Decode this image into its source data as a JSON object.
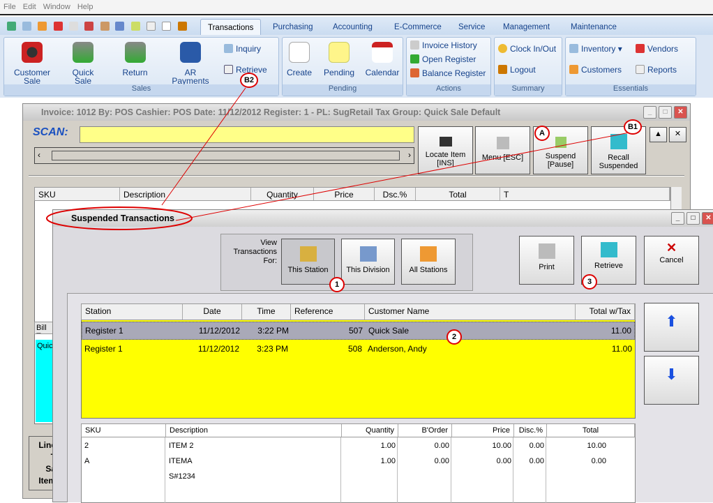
{
  "menu": [
    "File",
    "Edit",
    "Window",
    "Help"
  ],
  "tabs": [
    "Transactions",
    "Purchasing",
    "Accounting",
    "E-Commerce",
    "Service",
    "Management",
    "Maintenance"
  ],
  "ribbon": {
    "sales": {
      "label": "Sales",
      "customer_sale": "Customer Sale",
      "quick_sale": "Quick Sale",
      "return": "Return",
      "ar_payments": "AR Payments",
      "inquiry": "Inquiry",
      "retrieve": "Retrieve"
    },
    "pending": {
      "label": "Pending",
      "create": "Create",
      "pending": "Pending",
      "calendar": "Calendar"
    },
    "actions": {
      "label": "Actions",
      "invoice_history": "Invoice History",
      "open_register": "Open Register",
      "balance_register": "Balance Register"
    },
    "summary": {
      "label": "Summary",
      "clock": "Clock In/Out",
      "logout": "Logout"
    },
    "essentials": {
      "label": "Essentials",
      "inventory": "Inventory",
      "vendors": "Vendors",
      "customers": "Customers",
      "reports": "Reports"
    }
  },
  "invoice": {
    "title": "Invoice: 1012  By: POS  Cashier: POS  Date: 11/12/2012  Register: 1 - PL: SugRetail  Tax Group: Quick Sale Default",
    "scan_label": "SCAN:",
    "scan_value": "",
    "buttons": {
      "locate": "Locate Item [INS]",
      "menu": "Menu [ESC]",
      "suspend": "Suspend [Pause]",
      "recall": "Recall Suspended"
    },
    "columns": [
      "SKU",
      "Description",
      "Quantity",
      "Price",
      "Dsc.%",
      "Total",
      "T"
    ],
    "bill_tab": "Bill T",
    "bill_value": "Quic",
    "totals_labels": [
      "Line",
      "T",
      "Sa",
      "Item"
    ]
  },
  "dialog": {
    "title": "Suspended Transactions",
    "view_for": "View Transactions For:",
    "filters": [
      "This Station",
      "This Division",
      "All Stations"
    ],
    "print": "Print",
    "retrieve": "Retrieve",
    "cancel": "Cancel",
    "columns": [
      "Station",
      "Date",
      "Time",
      "Reference",
      "Customer Name",
      "Total w/Tax"
    ],
    "rows": [
      {
        "station": "Register 1",
        "date": "11/12/2012",
        "time": "3:22 PM",
        "reference": "507",
        "customer": "Quick Sale",
        "total": "11.00"
      },
      {
        "station": "Register 1",
        "date": "11/12/2012",
        "time": "3:23 PM",
        "reference": "508",
        "customer": "Anderson, Andy",
        "total": "11.00"
      }
    ],
    "detail_columns": [
      "SKU",
      "Description",
      "Quantity",
      "B'Order",
      "Price",
      "Disc.%",
      "Total"
    ],
    "detail_rows": [
      {
        "sku": "2",
        "desc": "ITEM 2",
        "qty": "1.00",
        "border": "0.00",
        "price": "10.00",
        "disc": "0.00",
        "total": "10.00"
      },
      {
        "sku": "A",
        "desc": "ITEMA",
        "qty": "1.00",
        "border": "0.00",
        "price": "0.00",
        "disc": "0.00",
        "total": "0.00"
      },
      {
        "sku": "",
        "desc": "S#1234",
        "qty": "",
        "border": "",
        "price": "",
        "disc": "",
        "total": ""
      }
    ]
  },
  "annotations": [
    "A",
    "B1",
    "B2",
    "1",
    "2",
    "3"
  ],
  "colors": {
    "highlight": "#ffff00",
    "selected": "#a9a9b8",
    "cyan": "#00ffff",
    "annotation": "#dd0000"
  }
}
